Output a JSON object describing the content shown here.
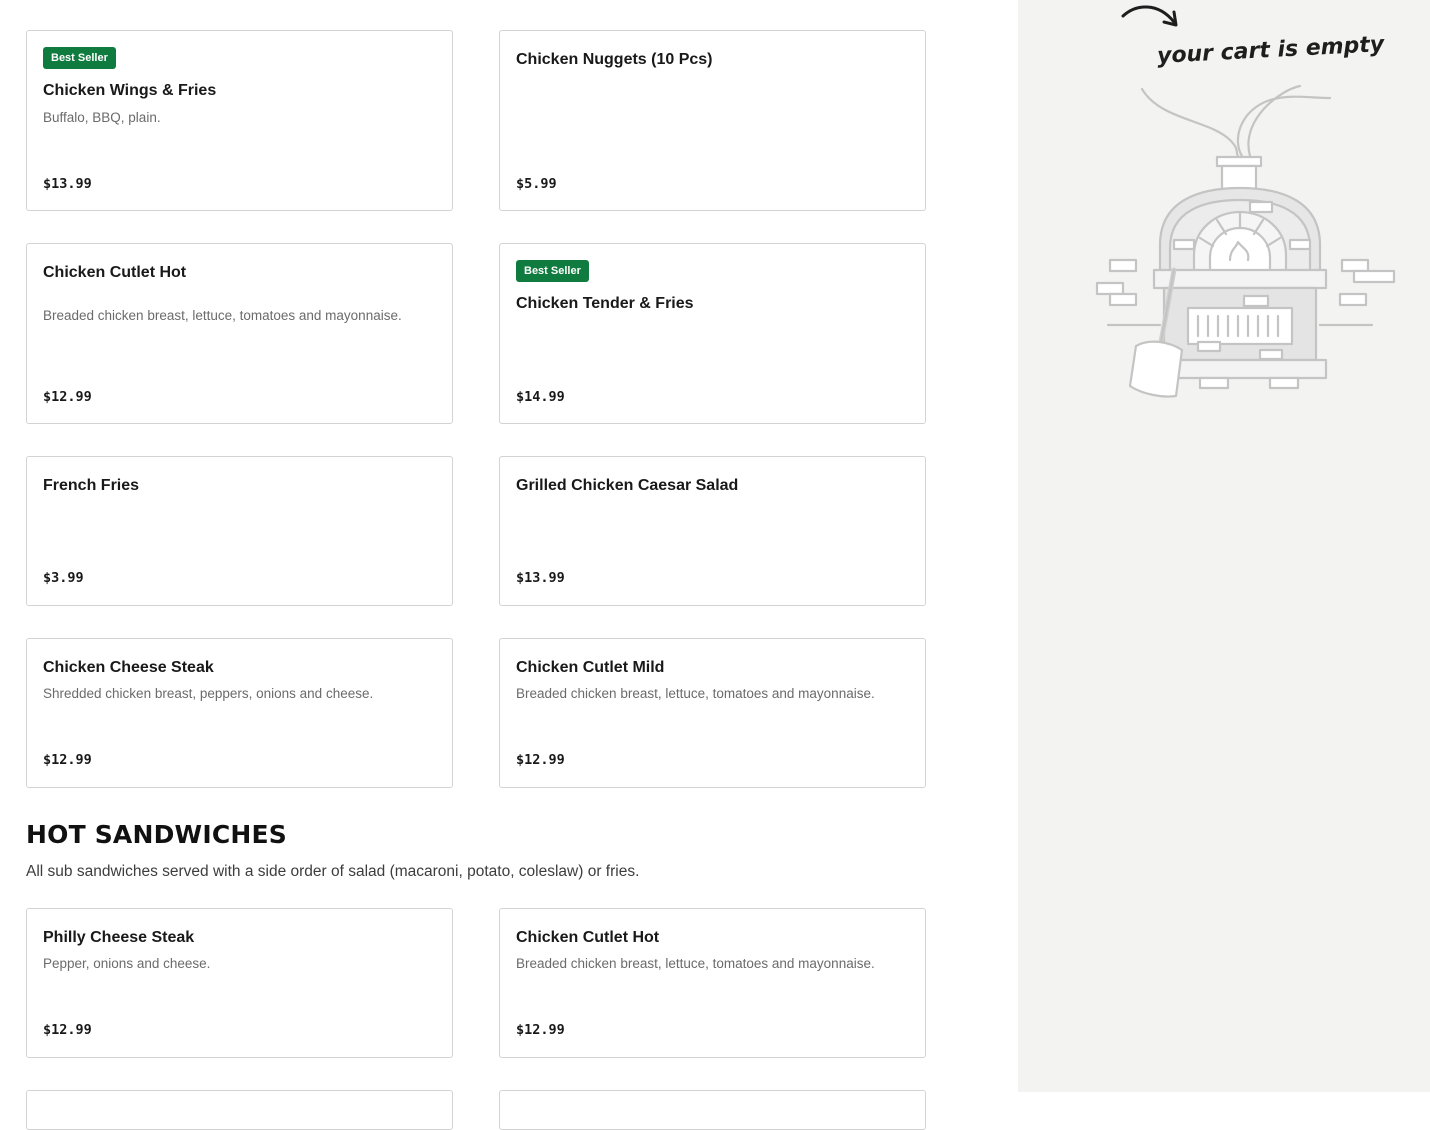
{
  "menu": {
    "cards": [
      {
        "name": "Chicken Wings & Fries",
        "description": "Buffalo, BBQ, plain.",
        "price": "$13.99",
        "badge": "Best Seller"
      },
      {
        "name": "Chicken Nuggets (10 Pcs)",
        "description": "",
        "price": "$5.99",
        "badge": ""
      },
      {
        "name": "Chicken Cutlet Hot",
        "description": "Breaded chicken breast, lettuce, tomatoes and mayonnaise.",
        "price": "$12.99",
        "badge": ""
      },
      {
        "name": "Chicken Tender & Fries",
        "description": "",
        "price": "$14.99",
        "badge": "Best Seller"
      },
      {
        "name": "French Fries",
        "description": "",
        "price": "$3.99",
        "badge": ""
      },
      {
        "name": "Grilled Chicken Caesar Salad",
        "description": "",
        "price": "$13.99",
        "badge": ""
      },
      {
        "name": "Chicken Cheese Steak",
        "description": "Shredded chicken breast, peppers, onions and cheese.",
        "price": "$12.99",
        "badge": ""
      },
      {
        "name": "Chicken Cutlet Mild",
        "description": "Breaded chicken breast, lettuce, tomatoes and mayonnaise.",
        "price": "$12.99",
        "badge": ""
      }
    ]
  },
  "hot_sandwiches": {
    "title": "HOT SANDWICHES",
    "description": "All sub sandwiches served with a side order of salad (macaroni, potato, coleslaw) or fries.",
    "cards": [
      {
        "name": "Philly Cheese Steak",
        "description": "Pepper, onions and cheese.",
        "price": "$12.99"
      },
      {
        "name": "Chicken Cutlet Hot",
        "description": "Breaded chicken breast, lettuce, tomatoes and mayonnaise.",
        "price": "$12.99"
      }
    ]
  },
  "cart": {
    "empty_text": "your cart is empty",
    "illustration_icon": "pizza-oven-illustration",
    "arrow_icon": "curved-arrow-icon"
  },
  "colors": {
    "badge": "#0f7b3f",
    "cart_background": "#f3f3f1",
    "card_border": "#d3d3d3"
  }
}
